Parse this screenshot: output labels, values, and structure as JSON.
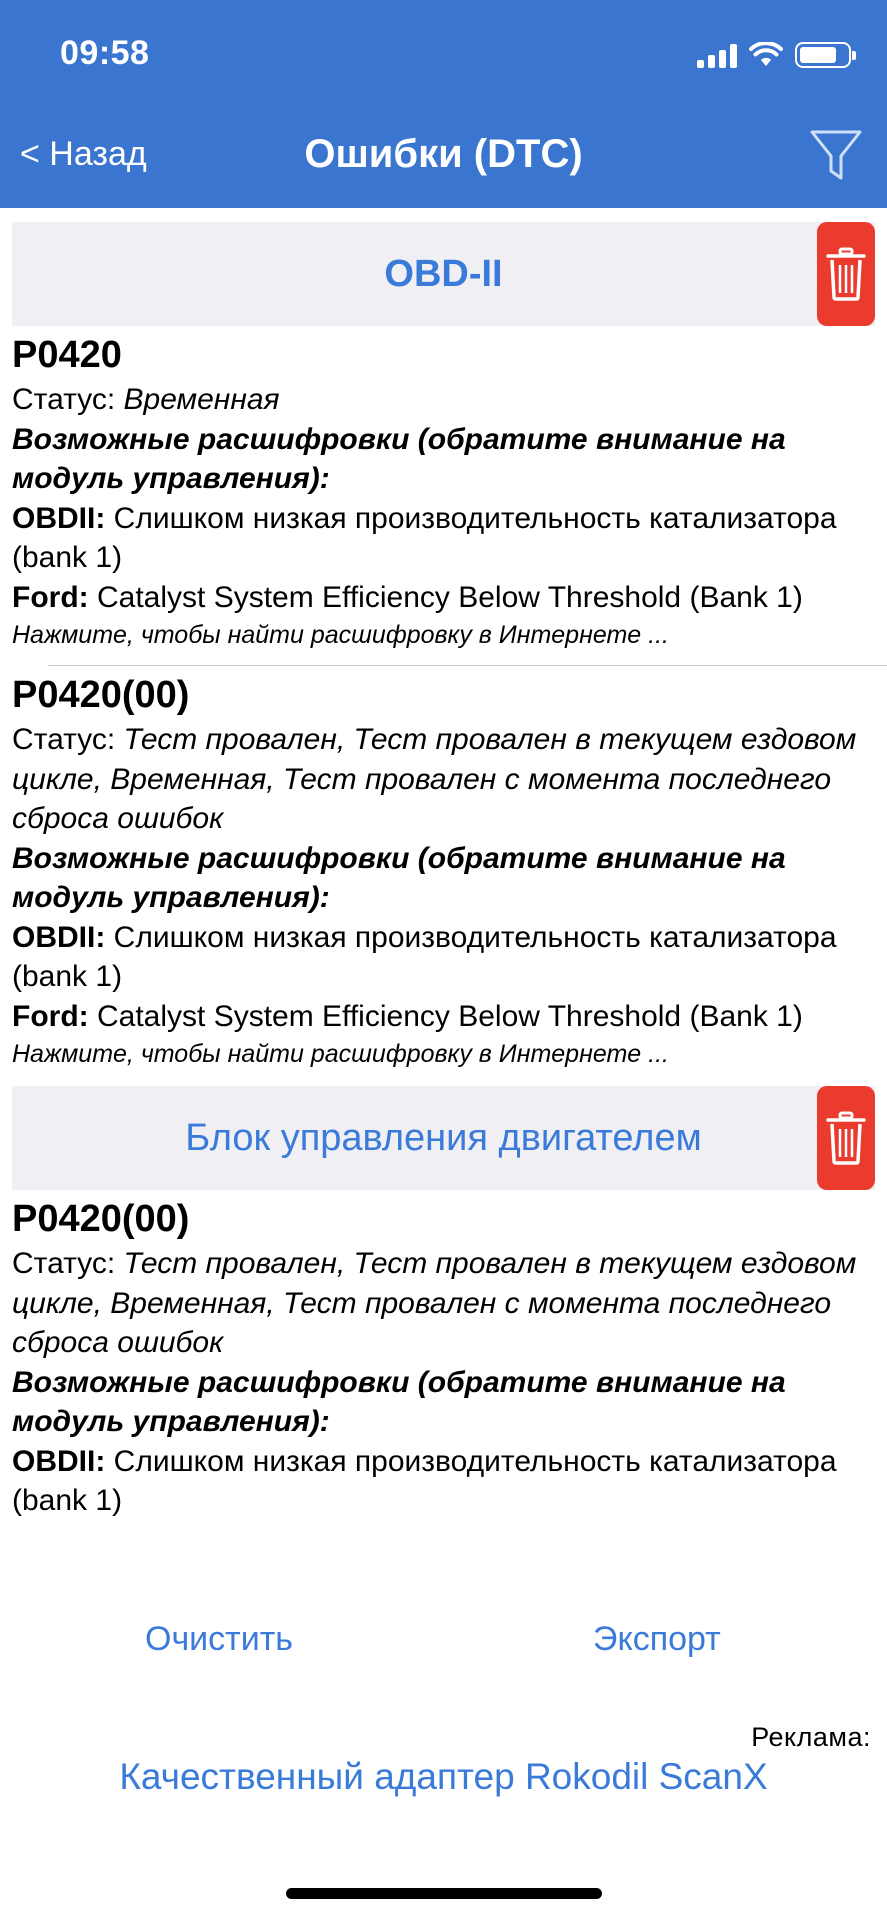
{
  "status_bar": {
    "time": "09:58"
  },
  "nav": {
    "back_label": "< Назад",
    "title": "Ошибки (DTC)"
  },
  "sections": [
    {
      "title": "OBD-II",
      "items": [
        {
          "code": "P0420",
          "status_label": "Статус:",
          "status_value": "Временная",
          "decodings_label": "Возможные расшифровки (обратите внимание на модуль управления):",
          "decodings": [
            {
              "source": "OBDII:",
              "text": "Слишком низкая производительность катализатора (bank 1)"
            },
            {
              "source": "Ford:",
              "text": "Catalyst System Efficiency Below Threshold (Bank 1)"
            }
          ],
          "hint": "Нажмите, чтобы найти расшифровку в Интернете ..."
        },
        {
          "code": "P0420(00)",
          "status_label": "Статус:",
          "status_value": "Тест провален, Тест провален в текущем ездовом цикле, Временная, Тест провален с момента последнего сброса ошибок",
          "decodings_label": "Возможные расшифровки (обратите внимание на модуль управления):",
          "decodings": [
            {
              "source": "OBDII:",
              "text": "Слишком низкая производительность катализатора (bank 1)"
            },
            {
              "source": "Ford:",
              "text": "Catalyst System Efficiency Below Threshold (Bank 1)"
            }
          ],
          "hint": "Нажмите, чтобы найти расшифровку в Интернете ..."
        }
      ]
    },
    {
      "title": "Блок управления двигателем",
      "items": [
        {
          "code": "P0420(00)",
          "status_label": "Статус:",
          "status_value": "Тест провален, Тест провален в текущем ездовом цикле, Временная, Тест провален с момента последнего сброса ошибок",
          "decodings_label": "Возможные расшифровки (обратите внимание на модуль управления):",
          "decodings": [
            {
              "source": "OBDII:",
              "text": "Слишком низкая производительность катализатора (bank 1)"
            }
          ]
        }
      ]
    }
  ],
  "bottom": {
    "clear_label": "Очистить",
    "export_label": "Экспорт"
  },
  "ad": {
    "label": "Реклама:",
    "link": "Качественный адаптер Rokodil ScanX"
  },
  "colors": {
    "header": "#3a76d0",
    "accent": "#3a7ad9",
    "delete": "#ea3b2e",
    "section_bg": "#efeff4"
  },
  "icons": [
    "filter-icon",
    "trash-icon",
    "wifi-icon",
    "battery-icon",
    "signal-icon"
  ]
}
